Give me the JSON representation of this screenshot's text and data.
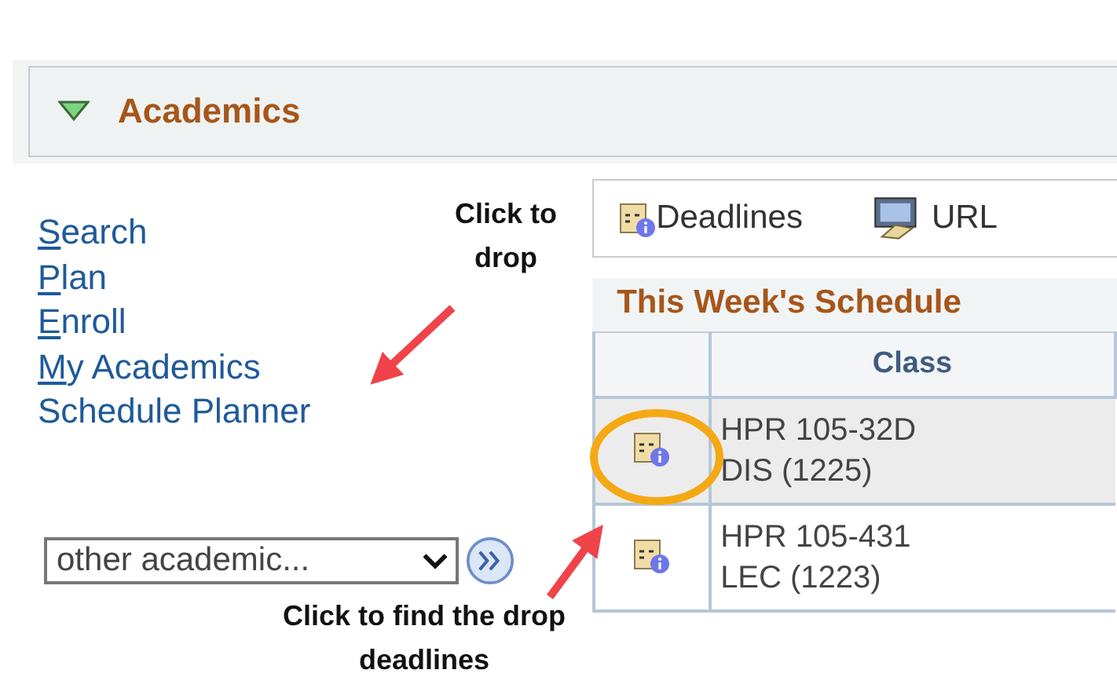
{
  "section": {
    "title": "Academics",
    "expanded": true
  },
  "links": [
    {
      "label": "Search",
      "access_key": true
    },
    {
      "label": "Plan",
      "access_key": true
    },
    {
      "label": "Enroll",
      "access_key": true
    },
    {
      "label": "My Academics",
      "access_key": true
    },
    {
      "label": "Schedule Planner",
      "access_key": false
    }
  ],
  "other_select": {
    "value": "other academic..."
  },
  "toolbar": [
    {
      "label": "Deadlines",
      "kind": "calendar"
    },
    {
      "label": "URL",
      "kind": "url"
    }
  ],
  "schedule": {
    "title": "This Week's Schedule",
    "columns": [
      "Class"
    ],
    "rows": [
      {
        "lines": [
          "HPR 105-32D",
          "DIS (1225)"
        ],
        "selected": true
      },
      {
        "lines": [
          "HPR 105-431",
          "LEC (1223)"
        ],
        "selected": false
      }
    ]
  },
  "annotations": [
    {
      "text": "Click to drop",
      "kind": "top"
    },
    {
      "text": "Click to find the drop deadlines",
      "kind": "bottom"
    }
  ]
}
